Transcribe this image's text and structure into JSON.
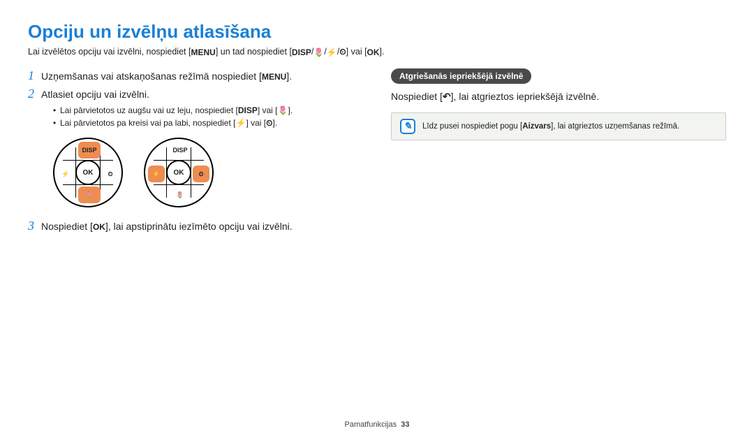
{
  "title": "Opciju un izvēlņu atlasīšana",
  "intro": {
    "text_a": "Lai izvēlētos opciju vai izvēlni, nospiediet [",
    "menu": "MENU",
    "text_b": "] un tad nospiediet [",
    "disp": "DISP",
    "slash1": "/",
    "macro": "🌷",
    "slash2": "/",
    "flash": "⚡",
    "slash3": "/",
    "timer": "⏲",
    "text_c": "] vai [",
    "ok": "OK",
    "text_d": "]."
  },
  "left": {
    "step1": {
      "num": "1",
      "text_a": "Uzņemšanas vai atskaņošanas režīmā nospiediet [",
      "label": "MENU",
      "text_b": "]."
    },
    "step2": {
      "num": "2",
      "text": "Atlasiet opciju vai izvēlni.",
      "bullets": [
        {
          "a": "Lai pārvietotos uz augšu vai uz leju, nospiediet [",
          "l1": "DISP",
          "mid": "] vai [",
          "l2": "🌷",
          "b": "]."
        },
        {
          "a": "Lai pārvietotos pa kreisi vai pa labi, nospiediet [",
          "l1": "⚡",
          "mid": "] vai [",
          "l2": "⏲",
          "b": "]."
        }
      ]
    },
    "step3": {
      "num": "3",
      "text_a": "Nospiediet [",
      "label": "OK",
      "text_b": "], lai apstiprinātu iezīmēto opciju vai izvēlni."
    },
    "dpad": {
      "top": "DISP",
      "ok": "OK",
      "flash": "⚡",
      "timer": "⏲",
      "macro": "🌷"
    }
  },
  "right": {
    "pill": "Atgriešanās iepriekšējā izvēlnē",
    "line": {
      "a": "Nospiediet [",
      "icon": "↶",
      "b": "], lai atgrieztos iepriekšējā izvēlnē."
    },
    "note": {
      "icon": "✎",
      "a": "Līdz pusei nospiediet pogu [",
      "bold": "Aizvars",
      "b": "], lai atgrieztos uzņemšanas režīmā."
    }
  },
  "footer": {
    "label": "Pamatfunkcijas",
    "page": "33"
  }
}
